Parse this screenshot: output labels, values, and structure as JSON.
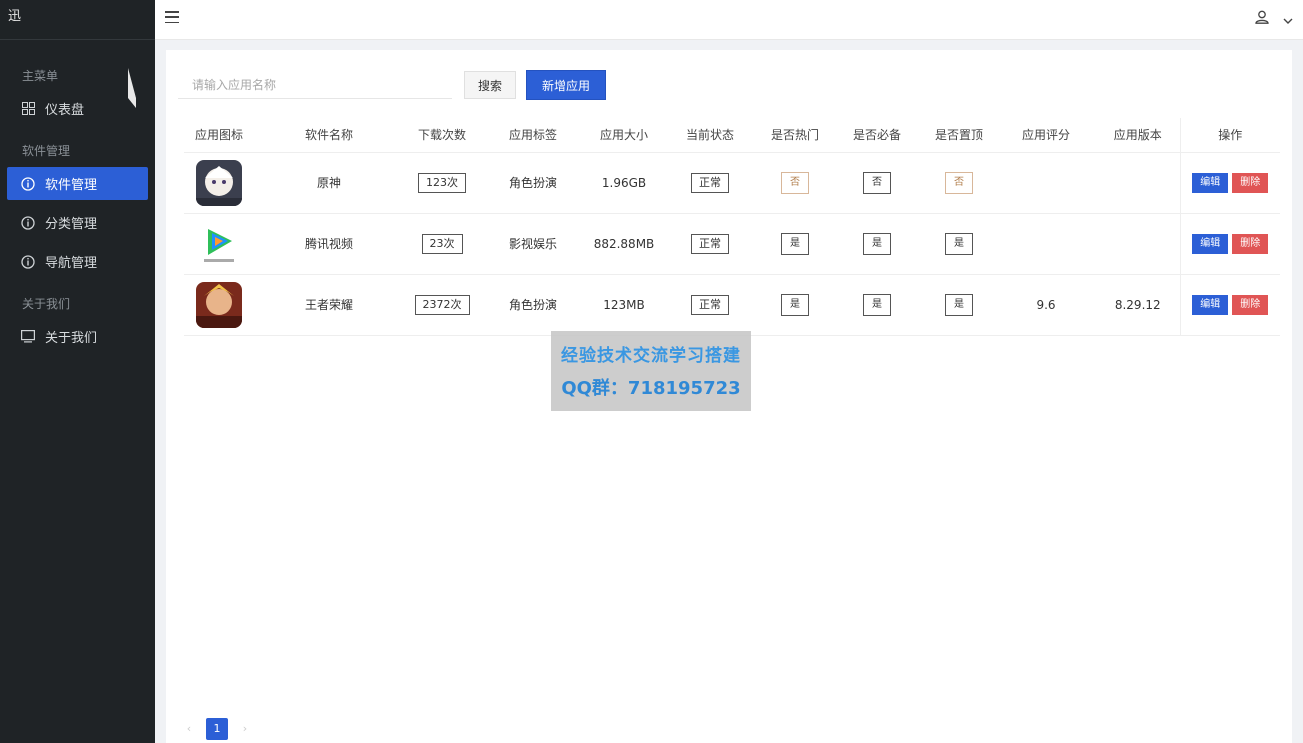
{
  "sidebar": {
    "brand": "迅",
    "groups": [
      {
        "label": "主菜单",
        "items": [
          {
            "label": "仪表盘"
          }
        ]
      },
      {
        "label": "软件管理",
        "items": [
          {
            "label": "软件管理"
          },
          {
            "label": "分类管理"
          },
          {
            "label": "导航管理"
          }
        ]
      },
      {
        "label": "关于我们",
        "items": [
          {
            "label": "关于我们"
          }
        ]
      }
    ]
  },
  "toolbar": {
    "search_placeholder": "请输入应用名称",
    "search_label": "搜索",
    "add_label": "新增应用"
  },
  "table": {
    "headers": [
      "应用图标",
      "软件名称",
      "下载次数",
      "应用标签",
      "应用大小",
      "当前状态",
      "是否热门",
      "是否必备",
      "是否置顶",
      "应用评分",
      "应用版本",
      "操作"
    ],
    "rows": [
      {
        "name": "原神",
        "downloads": "123次",
        "tag": "角色扮演",
        "size": "1.96GB",
        "status": "正常",
        "hot": "否",
        "must": "否",
        "top": "否",
        "rating": "",
        "version": ""
      },
      {
        "name": "腾讯视频",
        "downloads": "23次",
        "tag": "影视娱乐",
        "size": "882.88MB",
        "status": "正常",
        "hot": "是",
        "must": "是",
        "top": "是",
        "rating": "",
        "version": ""
      },
      {
        "name": "王者荣耀",
        "downloads": "2372次",
        "tag": "角色扮演",
        "size": "123MB",
        "status": "正常",
        "hot": "是",
        "must": "是",
        "top": "是",
        "rating": "9.6",
        "version": "8.29.12"
      }
    ],
    "edit_label": "编辑",
    "delete_label": "删除"
  },
  "watermark": {
    "line1": "经验技术交流学习搭建",
    "line2": "QQ群：718195723"
  },
  "pagination": {
    "prev": "‹",
    "current": "1",
    "next": "›"
  },
  "colors": {
    "primary": "#2c5fd6",
    "danger": "#e05555",
    "sidebar_bg": "#1f2326"
  }
}
